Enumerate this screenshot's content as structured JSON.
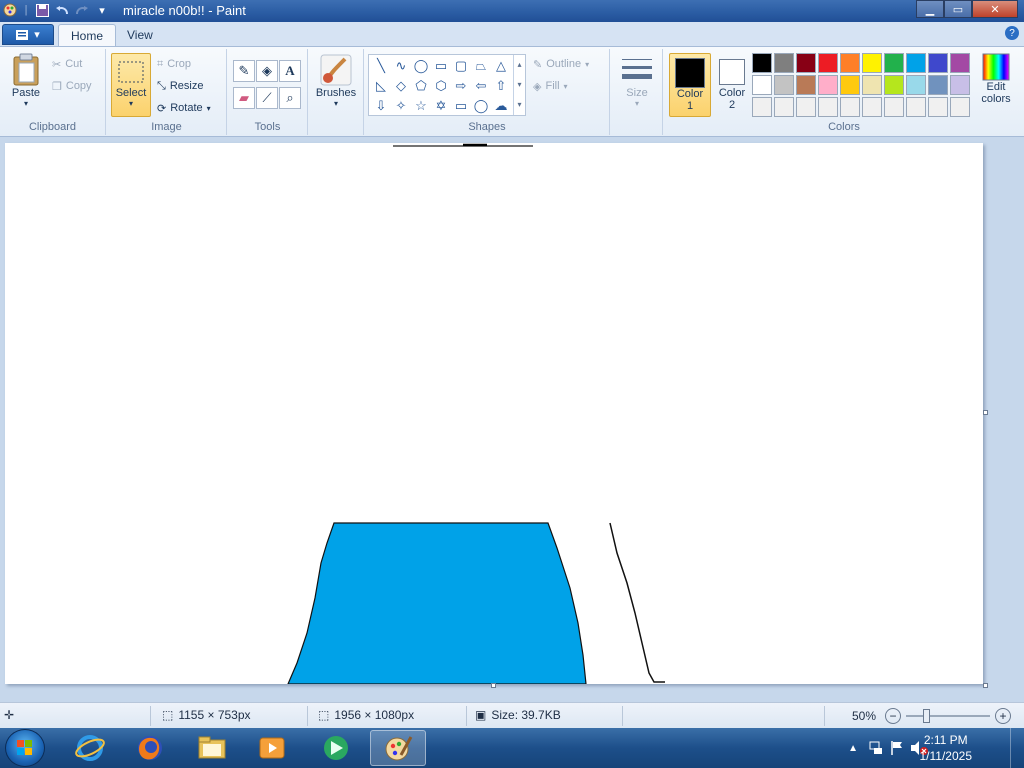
{
  "window": {
    "title": "miracle n00b!! - Paint",
    "min_label": "▁",
    "max_label": "▭",
    "close_label": "✕"
  },
  "tabs": [
    {
      "label": "Home"
    },
    {
      "label": "View"
    }
  ],
  "clipboard": {
    "group_label": "Clipboard",
    "paste": "Paste",
    "cut": "Cut",
    "copy": "Copy"
  },
  "image": {
    "group_label": "Image",
    "select": "Select",
    "crop": "Crop",
    "resize": "Resize",
    "rotate": "Rotate"
  },
  "tools": {
    "group_label": "Tools",
    "items": [
      "pencil-icon",
      "fill-icon",
      "text-icon",
      "eraser-icon",
      "color-picker-icon",
      "magnifier-icon"
    ]
  },
  "brushes": {
    "label": "Brushes"
  },
  "shapes": {
    "group_label": "Shapes",
    "outline": "Outline",
    "fill": "Fill"
  },
  "size": {
    "label": "Size"
  },
  "colors": {
    "group_label": "Colors",
    "color1_line1": "Color",
    "color1_line2": "1",
    "color2_line1": "Color",
    "color2_line2": "2",
    "edit_line1": "Edit",
    "edit_line2": "colors",
    "color1_value": "#000000",
    "color2_value": "#ffffff",
    "palette_row1": [
      "#000000",
      "#7f7f7f",
      "#880015",
      "#ed1c24",
      "#ff7f27",
      "#fff200",
      "#22b14c",
      "#00a2e8",
      "#3f48cc",
      "#a349a4"
    ],
    "palette_row2": [
      "#ffffff",
      "#c3c3c3",
      "#b97a57",
      "#ffaec9",
      "#ffc90e",
      "#efe4b0",
      "#b5e61d",
      "#99d9ea",
      "#7092be",
      "#c8bfe7"
    ],
    "palette_row3": [
      "#f0f0f0",
      "#f0f0f0",
      "#f0f0f0",
      "#f0f0f0",
      "#f0f0f0",
      "#f0f0f0",
      "#f0f0f0",
      "#f0f0f0",
      "#f0f0f0",
      "#f0f0f0"
    ]
  },
  "canvas": {
    "fill_color": "#00a2e8"
  },
  "status": {
    "selection_size": "1155 × 753px",
    "image_size": "1956 × 1080px",
    "file_size": "Size: 39.7KB",
    "zoom": "50%"
  },
  "taskbar": {
    "apps": [
      "internet-explorer-icon",
      "firefox-icon",
      "file-explorer-icon",
      "media-player-icon",
      "app-icon",
      "paint-icon"
    ],
    "time": "2:11 PM",
    "date": "1/11/2025"
  }
}
